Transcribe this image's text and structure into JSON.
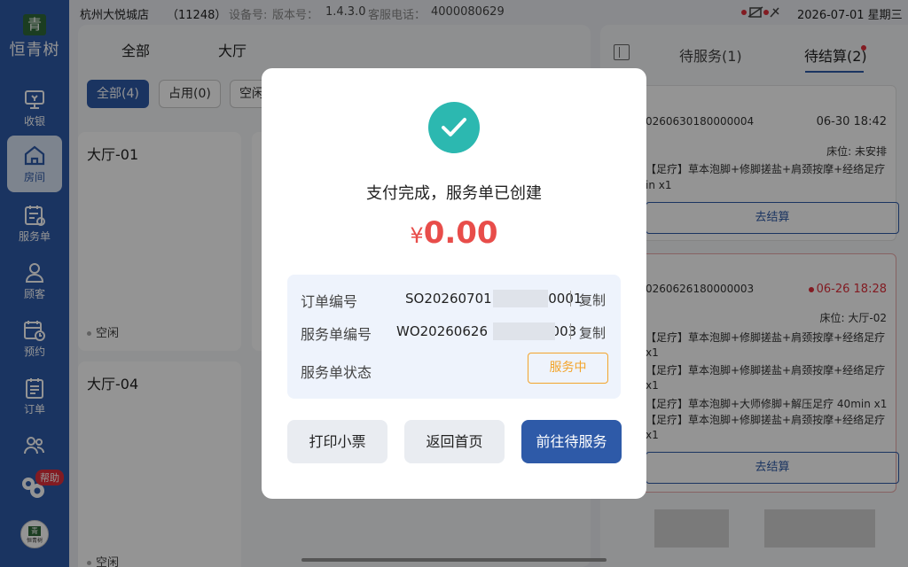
{
  "app": {
    "logo_text": "恒青树",
    "logo_badge": "青"
  },
  "sidebar": {
    "items": [
      {
        "label": "收银",
        "icon": "cashier-icon"
      },
      {
        "label": "房间",
        "icon": "home-icon",
        "active": true
      },
      {
        "label": "服务单",
        "icon": "service-order-icon"
      },
      {
        "label": "顾客",
        "icon": "customer-icon"
      },
      {
        "label": "预约",
        "icon": "appointment-icon"
      },
      {
        "label": "订单",
        "icon": "order-icon"
      },
      {
        "label": "",
        "icon": "staff-icon"
      }
    ],
    "help_label": "帮助",
    "avatar_text": "恒青树"
  },
  "statusbar": {
    "store": "杭州大悦城店",
    "store_code": "（11248）",
    "device_label": "设备号:",
    "version_label": "版本号：",
    "version": "1.4.3.0",
    "phone_label": "客服电话：",
    "phone": "4000080629",
    "datetime": "2026-07-01 星期三"
  },
  "room_panel": {
    "tabs": [
      "全部",
      "大厅"
    ],
    "filters": [
      "全部(4)",
      "占用(0)",
      "空闲"
    ],
    "rooms": [
      {
        "name": "大厅-01",
        "status": "空闲"
      },
      {
        "name": "大厅-04",
        "status": "空闲"
      }
    ]
  },
  "right_panel": {
    "tabs": [
      "待服务(1)",
      "待结算(2)"
    ],
    "orders": [
      {
        "id": "0260630180000004",
        "time": "06-30 18:42",
        "bed": "床位: 未安排",
        "lines": [
          "【足疗】草本泡脚+修脚搓盐+肩颈按摩+经络足疗",
          "in x1"
        ],
        "button": "去结算"
      },
      {
        "id": "0260626180000003",
        "time": "06-26 18:28",
        "bed": "床位: 大厅-02",
        "lines": [
          "【足疗】草本泡脚+修脚搓盐+肩颈按摩+经络足疗",
          "x1",
          "【足疗】草本泡脚+修脚搓盐+肩颈按摩+经络足疗",
          "x1",
          "【足疗】草本泡脚+大师修脚+解压足疗 40min x1",
          "【足疗】草本泡脚+修脚搓盐+肩颈按摩+经络足疗",
          "x1"
        ],
        "button": "去结算"
      }
    ]
  },
  "modal": {
    "title": "支付完成，服务单已创建",
    "currency": "¥",
    "amount": "0.00",
    "order_no_label": "订单编号",
    "order_no_prefix": "SO20260701",
    "order_no_suffix": "00001",
    "service_no_label": "服务单编号",
    "service_no_prefix": "WO20260626",
    "service_no_suffix": "0003",
    "copy_label": "复制",
    "status_label": "服务单状态",
    "status_value": "服务中",
    "buttons": {
      "print": "打印小票",
      "home": "返回首页",
      "goto": "前往待服务"
    }
  },
  "colors": {
    "accent": "#2e5aa8",
    "success": "#2cb8b0",
    "amount": "#e84d4a",
    "status": "#f3a42b"
  }
}
